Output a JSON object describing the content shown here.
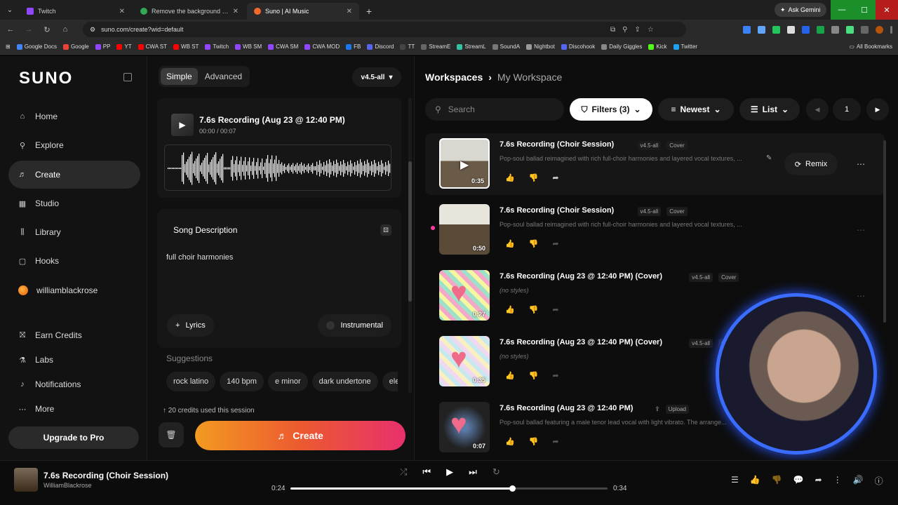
{
  "browser": {
    "tabs": [
      {
        "title": "Twitch",
        "color": "#9146ff",
        "active": false
      },
      {
        "title": "Remove the background and e...",
        "color": "#34a853",
        "active": false
      },
      {
        "title": "Suno | AI Music",
        "color": "#f06a2c",
        "active": true
      }
    ],
    "ask_gemini": "Ask Gemini",
    "url": "suno.com/create?wid=default",
    "bookmarks": [
      {
        "label": "Google Docs",
        "color": "#4285f4"
      },
      {
        "label": "Google",
        "color": "#ea4335"
      },
      {
        "label": "PP",
        "color": "#9146ff"
      },
      {
        "label": "YT",
        "color": "#ff0000"
      },
      {
        "label": "CWA ST",
        "color": "#ff0000"
      },
      {
        "label": "WB ST",
        "color": "#ff0000"
      },
      {
        "label": "Twitch",
        "color": "#9146ff"
      },
      {
        "label": "WB SM",
        "color": "#9146ff"
      },
      {
        "label": "CWA SM",
        "color": "#9146ff"
      },
      {
        "label": "CWA MOD",
        "color": "#9146ff"
      },
      {
        "label": "FB",
        "color": "#1877f2"
      },
      {
        "label": "Discord",
        "color": "#5865f2"
      },
      {
        "label": "TT",
        "color": "#444444"
      },
      {
        "label": "StreamE",
        "color": "#666666"
      },
      {
        "label": "StreamL",
        "color": "#31c3a2"
      },
      {
        "label": "SoundA",
        "color": "#777777"
      },
      {
        "label": "Nightbot",
        "color": "#999999"
      },
      {
        "label": "Discohook",
        "color": "#5865f2"
      },
      {
        "label": "Daily Giggles",
        "color": "#888888"
      },
      {
        "label": "Kick",
        "color": "#53fc18"
      },
      {
        "label": "Twitter",
        "color": "#1da1f2"
      }
    ],
    "all_bookmarks": "All Bookmarks"
  },
  "sidebar": {
    "logo": "SUNO",
    "items": [
      {
        "label": "Home",
        "icon": "home-icon",
        "glyph": "⌂"
      },
      {
        "label": "Explore",
        "icon": "search-icon",
        "glyph": "⚲"
      },
      {
        "label": "Create",
        "icon": "music-note-icon",
        "glyph": "♬"
      },
      {
        "label": "Studio",
        "icon": "studio-icon",
        "glyph": "▦"
      },
      {
        "label": "Library",
        "icon": "library-icon",
        "glyph": "⫼"
      },
      {
        "label": "Hooks",
        "icon": "hooks-icon",
        "glyph": "▢"
      },
      {
        "label": "williamblackrose",
        "icon": "avatar",
        "glyph": ""
      },
      {
        "label": "Earn Credits",
        "icon": "gift-icon",
        "glyph": "⛝"
      },
      {
        "label": "Labs",
        "icon": "flask-icon",
        "glyph": "⚗"
      },
      {
        "label": "Notifications",
        "icon": "bell-icon",
        "glyph": "♪"
      },
      {
        "label": "More",
        "icon": "more-icon",
        "glyph": "⋯"
      }
    ],
    "upgrade": "Upgrade to Pro"
  },
  "create": {
    "mode_simple": "Simple",
    "mode_advanced": "Advanced",
    "version": "v4.5-all",
    "recording": {
      "title": "7.6s Recording (Aug 23 @ 12:40 PM)",
      "time": "00:00 / 00:07"
    },
    "description_title": "Song Description",
    "description_text": "full choir harmonies",
    "lyrics": "Lyrics",
    "instrumental": "Instrumental",
    "suggestions_label": "Suggestions",
    "suggestions": [
      "rock latino",
      "140 bpm",
      "e minor",
      "dark undertone",
      "electro"
    ],
    "credits": "20 credits used this session",
    "create_btn": "Create"
  },
  "workspace": {
    "crumb_root": "Workspaces",
    "crumb_current": "My Workspace",
    "search_placeholder": "Search",
    "filters": "Filters (3)",
    "sort": "Newest",
    "view": "List",
    "page": "1",
    "remix": "Remix",
    "songs": [
      {
        "title": "7.6s Recording (Choir Session)",
        "version": "v4.5-all",
        "tag": "Cover",
        "desc": "Pop-soul ballad reimagined with rich full-choir harmonies and layered vocal textures, ...",
        "duration": "0:35",
        "italic": false
      },
      {
        "title": "7.6s Recording (Choir Session)",
        "version": "v4.5-all",
        "tag": "Cover",
        "desc": "Pop-soul ballad reimagined with rich full-choir harmonies and layered vocal textures, ...",
        "duration": "0:50",
        "italic": false
      },
      {
        "title": "7.6s Recording (Aug 23 @ 12:40 PM) (Cover)",
        "version": "v4.5-all",
        "tag": "Cover",
        "desc": "(no styles)",
        "duration": "0:27",
        "italic": true
      },
      {
        "title": "7.6s Recording (Aug 23 @ 12:40 PM) (Cover)",
        "version": "v4.5-all",
        "tag": "Cover",
        "desc": "(no styles)",
        "duration": "0:35",
        "italic": true
      },
      {
        "title": "7.6s Recording (Aug 23 @ 12:40 PM)",
        "version": "",
        "tag": "Upload",
        "desc": "Pop-soul ballad featuring a male tenor lead vocal with light vibrato. The arrange...",
        "duration": "0:07",
        "italic": false
      }
    ]
  },
  "player": {
    "title": "7.6s Recording (Choir Session)",
    "artist": "WilliamBlackrose",
    "current": "0:24",
    "total": "0:34",
    "progress": 0.7
  }
}
